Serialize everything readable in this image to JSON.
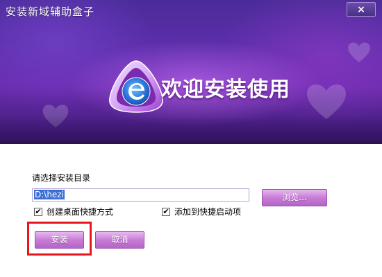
{
  "window": {
    "title": "安装新域辅助盒子",
    "close_label": "×"
  },
  "banner": {
    "welcome_text": "欢迎安装使用",
    "logo_icon": "e-logo-icon"
  },
  "install": {
    "dir_label": "请选择安装目录",
    "path_value": "D:\\hezi",
    "browse_label": "浏览...",
    "options": [
      {
        "label": "创建桌面快捷方式",
        "checked": true
      },
      {
        "label": "添加到快捷启动项",
        "checked": true
      }
    ],
    "install_label": "安装",
    "cancel_label": "取消"
  },
  "colors": {
    "banner_primary": "#5d2eab",
    "button_purple": "#c87cd6",
    "highlight_red": "#e8141e",
    "selection_blue": "#3b6fd6"
  }
}
